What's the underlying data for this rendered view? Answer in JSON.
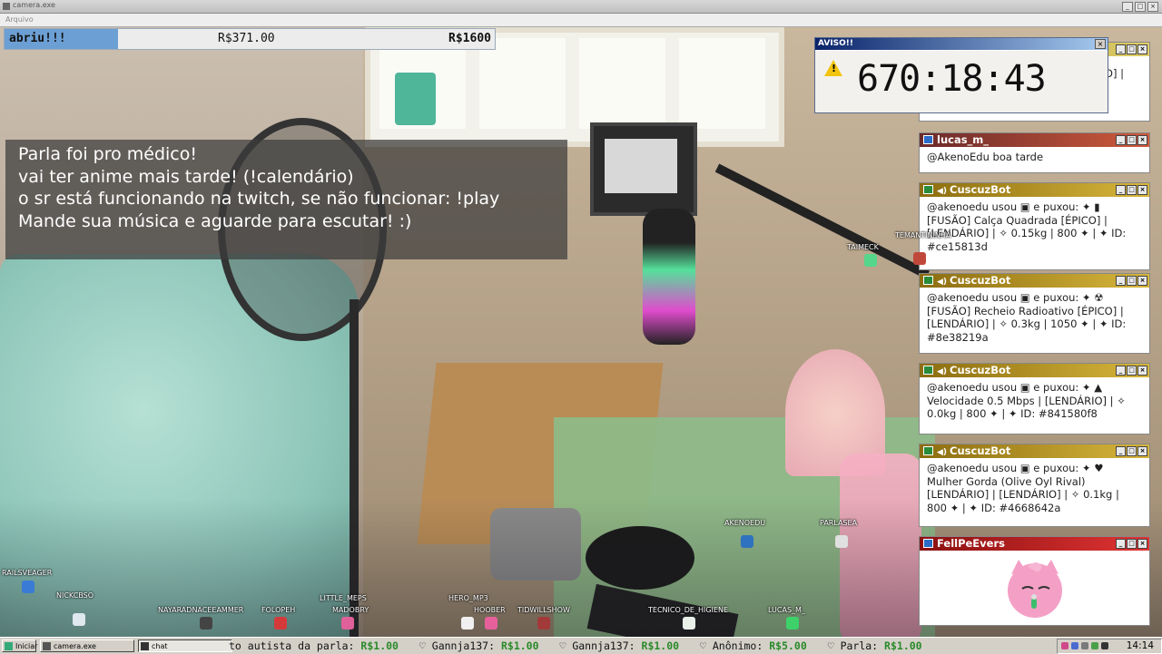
{
  "window": {
    "title": "camera.exe",
    "menu": "Arquivo"
  },
  "donation_bar": {
    "label": "abriu!!!",
    "current": "R$371.00",
    "goal": "R$1600",
    "progress": 0.232
  },
  "announcement": {
    "lines": [
      "Parla foi pro médico!",
      "vai ter anime mais tarde! (!calendário)",
      "o sr está funcionando na twitch, se não funcionar: !play",
      "Mande sua música e aguarde para escutar! :)"
    ]
  },
  "timer": {
    "title": "AVISO!!",
    "warn_icon": "!",
    "time": "670:18:43"
  },
  "chat_windows": [
    {
      "user": "",
      "header_color": "#e0cf6a",
      "lines": [
        "",
        "",
        "ÃO] |"
      ]
    },
    {
      "user": "lucas_m_",
      "header_color": "#cf5a3c",
      "lines": [
        "@AkenoEdu boa tarde"
      ]
    },
    {
      "user": "CuscuzBot",
      "header_color": "#d7b63b",
      "lines": [
        "@akenoedu usou ▣ e puxou: ✦ ▮",
        "[FUSÃO] Calça Quadrada [ÉPICO] |",
        "[LENDÁRIO] | ✧ 0.15kg | 800 ✦ | ✦ ID:",
        "#ce15813d"
      ]
    },
    {
      "user": "CuscuzBot",
      "header_color": "#d7b63b",
      "lines": [
        "@akenoedu usou ▣ e puxou: ✦ ☢",
        "[FUSÃO] Recheio Radioativo [ÉPICO] |",
        "[LENDÁRIO] | ✧ 0.3kg | 1050 ✦ | ✦ ID:",
        "#8e38219a"
      ]
    },
    {
      "user": "CuscuzBot",
      "header_color": "#d7b63b",
      "lines": [
        "@akenoedu usou ▣ e puxou: ✦ ▲",
        "Velocidade 0.5 Mbps | [LENDÁRIO] | ✧",
        "0.0kg | 800 ✦ | ✦ ID: #841580f8"
      ]
    },
    {
      "user": "CuscuzBot",
      "header_color": "#d7b63b",
      "lines": [
        "@akenoedu usou ▣ e puxou: ✦ ♥",
        "Mulher Gorda (Olive Oyl Rival)",
        "[LENDÁRIO] | [LENDÁRIO] | ✧ 0.1kg |",
        "800 ✦ | ✦ ID: #4668642a"
      ]
    },
    {
      "user": "FellPeEvers",
      "header_color": "#e23434",
      "lines": []
    }
  ],
  "avatars": [
    "TAIMECK",
    "TEMANTININHA",
    "AKENOEDU",
    "PARLASEA",
    "RAILSVEAGER",
    "NICKCBSO",
    "NAYARADNACEEAMMER",
    "FOLOPEH",
    "LITTLE_MEPS",
    "MADOBRY",
    "HERO_MP3",
    "HOOBER",
    "TIDWILLSHOW",
    "TECNICO_DE_HIGIENE",
    "LUCAS_M_"
  ],
  "taskbar": {
    "start": "Iniciar",
    "buttons": [
      "camera.exe",
      "chat"
    ],
    "ticker": [
      {
        "name": "to autista da parla:",
        "amount": "R$1.00"
      },
      {
        "name": "Gannja137:",
        "amount": "R$1.00"
      },
      {
        "name": "Gannja137:",
        "amount": "R$1.00"
      },
      {
        "name": "Anônimo:",
        "amount": "R$5.00"
      },
      {
        "name": "Parla:",
        "amount": "R$1.00"
      }
    ],
    "clock": "14:14"
  }
}
